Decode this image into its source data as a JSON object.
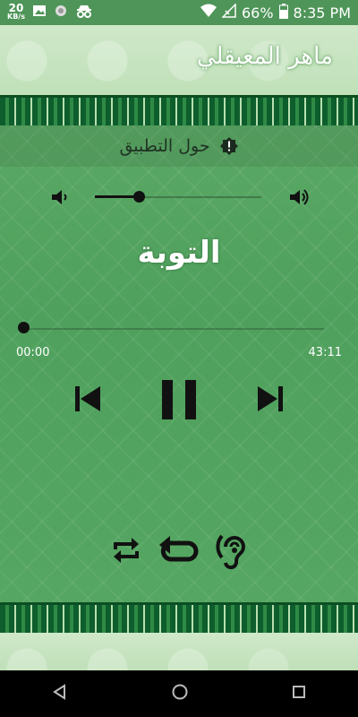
{
  "status_bar": {
    "speed_value": "20",
    "speed_unit": "KB/s",
    "battery": "66%",
    "time": "8:35 PM"
  },
  "header": {
    "title": "ماهر المعيقلي"
  },
  "about": {
    "label": "حول التطبيق"
  },
  "player": {
    "surah_name": "التوبة",
    "current_time": "00:00",
    "total_time": "43:11",
    "volume_level": 0.27,
    "progress": 0.0
  },
  "colors": {
    "status_bar": "#4f9559",
    "background": "#55a662",
    "border_dark": "#0d5e2c",
    "icon": "#111111"
  },
  "icons": {
    "status": [
      "image-icon",
      "circle-icon",
      "incognito-icon",
      "wifi-icon",
      "signal-icon",
      "battery-icon"
    ],
    "controls": [
      "skip-previous-icon",
      "pause-icon",
      "skip-next-icon",
      "repeat-icon",
      "loop-icon",
      "hearing-icon"
    ],
    "nav": [
      "back-icon",
      "home-icon",
      "recents-icon"
    ]
  }
}
